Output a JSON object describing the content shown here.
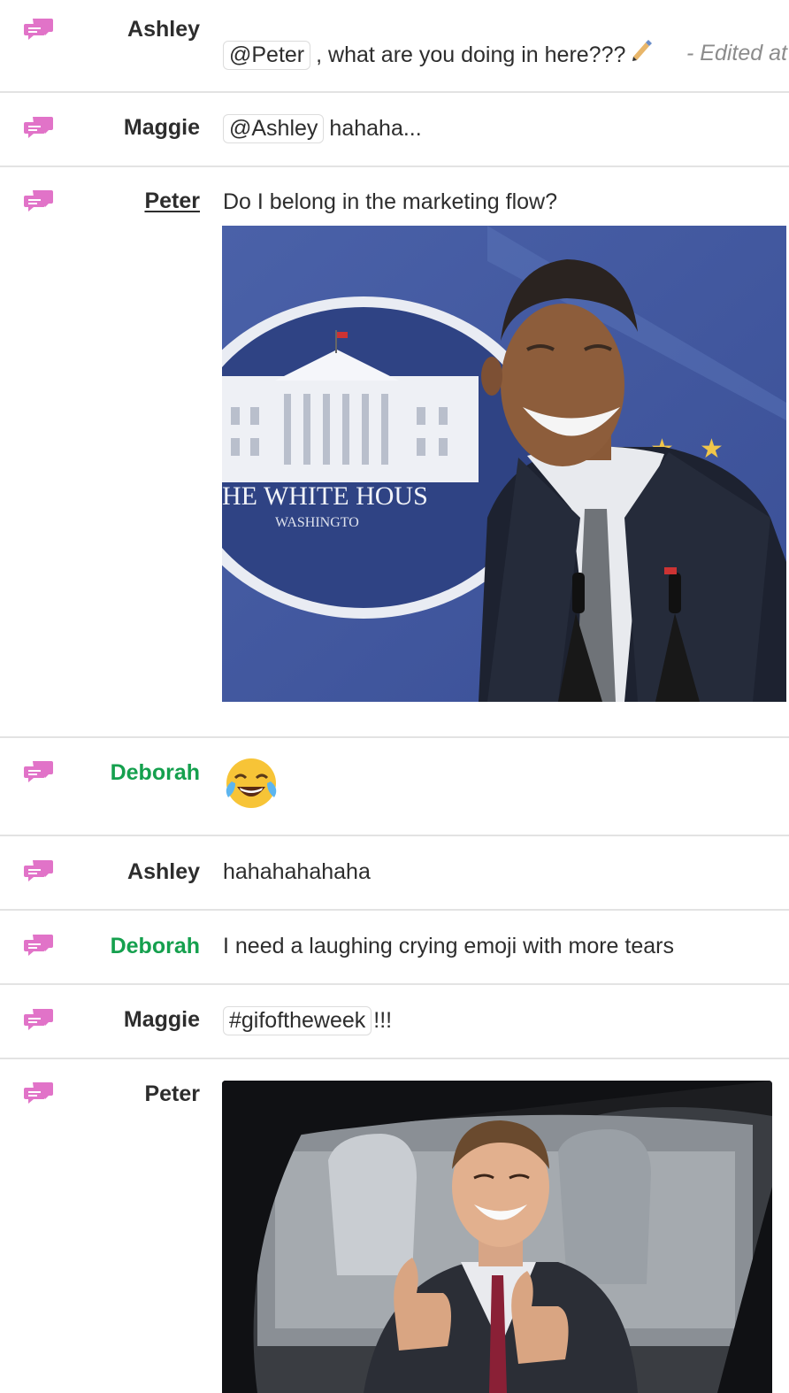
{
  "messages": [
    {
      "author": "Ashley",
      "mention": "@Peter",
      "text": ", what are you doing in here???",
      "edited": "- Edited at"
    },
    {
      "author": "Maggie",
      "mention": "@Ashley",
      "text": "hahaha..."
    },
    {
      "author": "Peter",
      "text": "Do I belong in the marketing flow?",
      "gif_sign_line1": "HE WHITE HOUS",
      "gif_sign_line2": "WASHINGTO"
    },
    {
      "author": "Deborah",
      "emoji": "face-with-tears-of-joy"
    },
    {
      "author": "Ashley",
      "text": "hahahahahaha"
    },
    {
      "author": "Deborah",
      "text": "I need a laughing crying emoji with more tears"
    },
    {
      "author": "Maggie",
      "hashtag": "#gifoftheweek",
      "text": "!!!"
    },
    {
      "author": "Peter"
    }
  ],
  "colors": {
    "reply_icon": "#e173c8",
    "deborah": "#15a04e",
    "divider": "#e3e3e3",
    "text": "#2d2d2d"
  },
  "icons": {
    "reply": "speech-bubbles-icon",
    "edit": "edit-pencil-icon"
  }
}
